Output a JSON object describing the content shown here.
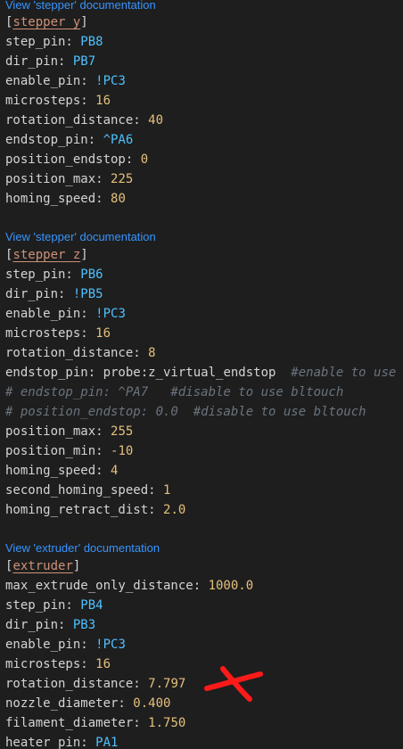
{
  "doc_links": {
    "stepper_y": "View 'stepper' documentation",
    "stepper_z": "View 'stepper' documentation",
    "extruder": "View 'extruder' documentation"
  },
  "stepper_y": {
    "section": "stepper_y",
    "lines": [
      {
        "key": "step_pin: ",
        "value": "PB8",
        "kind": "pin"
      },
      {
        "key": "dir_pin: ",
        "value": "PB7",
        "kind": "pin"
      },
      {
        "key": "enable_pin: ",
        "value": "!PC3",
        "kind": "pin"
      },
      {
        "key": "microsteps: ",
        "value": "16",
        "kind": "num"
      },
      {
        "key": "rotation_distance: ",
        "value": "40",
        "kind": "num"
      },
      {
        "key": "endstop_pin: ",
        "value": "^PA6",
        "kind": "pin"
      },
      {
        "key": "position_endstop: ",
        "value": "0",
        "kind": "num"
      },
      {
        "key": "position_max: ",
        "value": "225",
        "kind": "num"
      },
      {
        "key": "homing_speed: ",
        "value": "80",
        "kind": "num"
      }
    ]
  },
  "stepper_z": {
    "section": "stepper_z",
    "lines": [
      {
        "key": "step_pin: ",
        "value": "PB6",
        "kind": "pin"
      },
      {
        "key": "dir_pin: ",
        "value": "!PB5",
        "kind": "pin"
      },
      {
        "key": "enable_pin: ",
        "value": "!PC3",
        "kind": "pin"
      },
      {
        "key": "microsteps: ",
        "value": "16",
        "kind": "num"
      },
      {
        "key": "rotation_distance: ",
        "value": "8",
        "kind": "num"
      },
      {
        "key": "endstop_pin: ",
        "value": "probe:z_virtual_endstop",
        "kind": "val",
        "comment": "  #enable to use"
      },
      {
        "comment_line": "# endstop_pin: ^PA7   #disable to use bltouch"
      },
      {
        "comment_line": "# position_endstop: 0.0  #disable to use bltouch"
      },
      {
        "key": "position_max: ",
        "value": "255",
        "kind": "num"
      },
      {
        "key": "position_min: ",
        "value": "-10",
        "kind": "num"
      },
      {
        "key": "homing_speed: ",
        "value": "4",
        "kind": "num"
      },
      {
        "key": "second_homing_speed: ",
        "value": "1",
        "kind": "num"
      },
      {
        "key": "homing_retract_dist: ",
        "value": "2.0",
        "kind": "num"
      }
    ]
  },
  "extruder": {
    "section": "extruder",
    "lines": [
      {
        "key": "max_extrude_only_distance: ",
        "value": "1000.0",
        "kind": "num"
      },
      {
        "key": "step_pin: ",
        "value": "PB4",
        "kind": "pin"
      },
      {
        "key": "dir_pin: ",
        "value": "PB3",
        "kind": "pin"
      },
      {
        "key": "enable_pin: ",
        "value": "!PC3",
        "kind": "pin"
      },
      {
        "key": "microsteps: ",
        "value": "16",
        "kind": "num"
      },
      {
        "key": "rotation_distance: ",
        "value": "7.797",
        "kind": "num"
      },
      {
        "key": "nozzle_diameter: ",
        "value": "0.400",
        "kind": "num"
      },
      {
        "key": "filament_diameter: ",
        "value": "1.750",
        "kind": "num"
      },
      {
        "key": "heater_pin: ",
        "value": "PA1",
        "kind": "pin"
      }
    ]
  },
  "colors": {
    "background": "#1e1e1e",
    "link": "#3794ff",
    "number": "#e5c07b",
    "pin": "#4fc1ff",
    "section": "#ce9178",
    "comment": "#6a737d",
    "annotation_mark": "#ff1a1a"
  }
}
